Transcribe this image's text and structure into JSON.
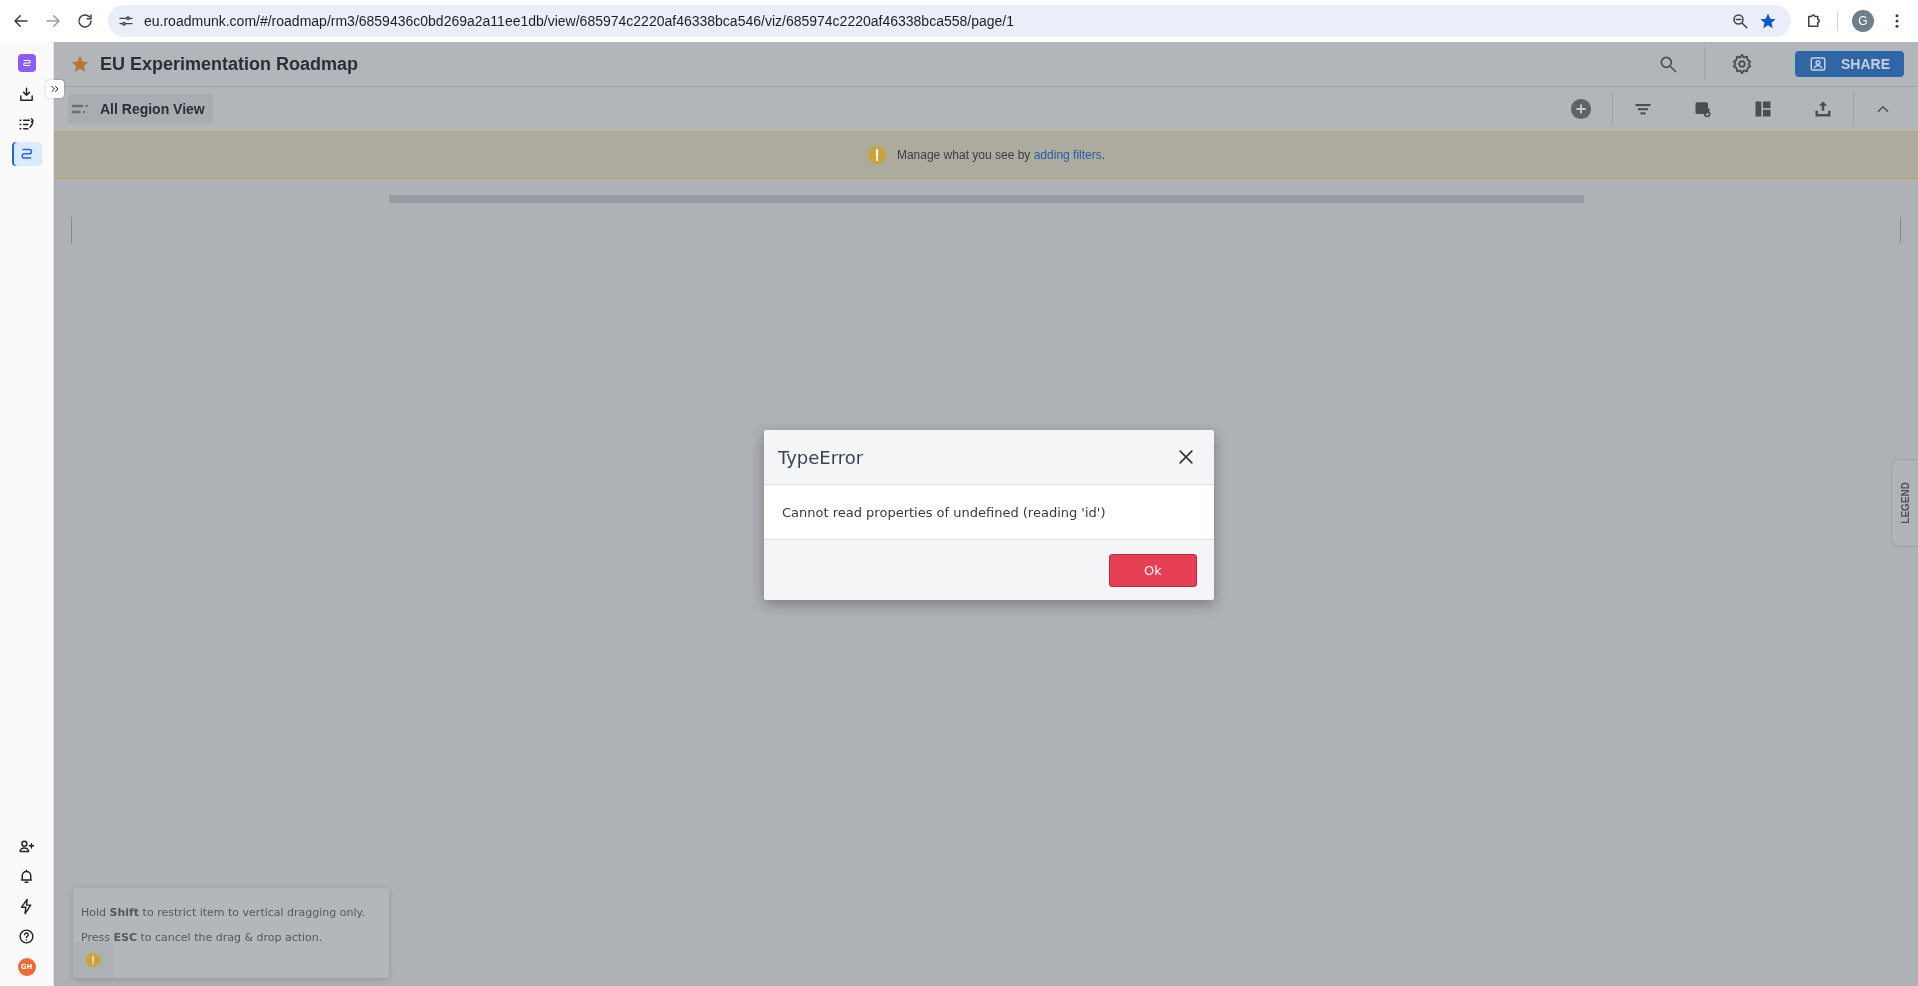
{
  "browser": {
    "url": "eu.roadmunk.com/#/roadmap/rm3/6859436c0bd269a2a11ee1db/view/685974c2220af46338bca546/viz/685974c2220af46338bca558/page/1",
    "bookmarked": true,
    "profile_initial": "G"
  },
  "sidebar": {
    "top_items": [
      {
        "kind": "download",
        "selected": false
      },
      {
        "kind": "list",
        "selected": false
      },
      {
        "kind": "roadmap",
        "selected": true
      }
    ],
    "bottom_items": [
      {
        "kind": "add-user"
      },
      {
        "kind": "bell"
      },
      {
        "kind": "bolt"
      },
      {
        "kind": "help"
      }
    ],
    "avatar_initials": "GH"
  },
  "header": {
    "title": "EU Experimentation Roadmap",
    "starred": true,
    "share_label": "SHARE"
  },
  "toolbar": {
    "view_name": "All Region View"
  },
  "banner": {
    "text": "Manage what you see by ",
    "link": "adding filters",
    "end": "."
  },
  "legend_tab": "LEGEND",
  "dialog": {
    "title": "TypeError",
    "message": "Cannot read properties of undefined (reading 'id')",
    "button": "Ok"
  },
  "toast": {
    "lines": [
      "Hold **Shift** to restrict item to vertical dragging only.",
      "Press **ESC** to cancel the drag & drop action."
    ]
  }
}
